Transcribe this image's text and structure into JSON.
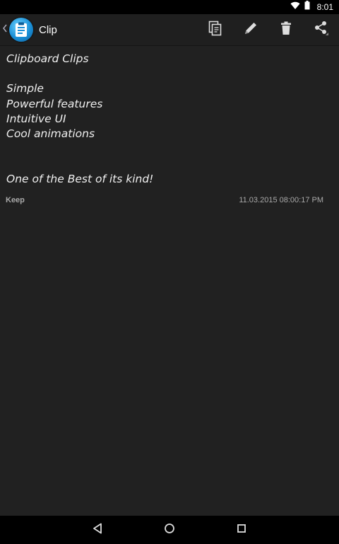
{
  "status_bar": {
    "time": "8:01",
    "icons": [
      "wifi-icon",
      "battery-icon"
    ]
  },
  "app_bar": {
    "title": "Clip",
    "actions": [
      "copy-icon",
      "edit-pencil-icon",
      "trash-icon",
      "share-icon"
    ]
  },
  "clip": {
    "lines": [
      "Clipboard Clips",
      "",
      "Simple",
      "Powerful features",
      "Intuitive UI",
      "Cool animations",
      "",
      "",
      "One of the Best of its kind!"
    ],
    "tag": "Keep",
    "timestamp": "11.03.2015  08:00:17 PM"
  },
  "nav_bar": {
    "buttons": [
      "back-triangle-icon",
      "home-circle-icon",
      "recents-square-icon"
    ]
  },
  "colors": {
    "background": "#212121",
    "app_bar": "#1f1f1f",
    "status_bar": "#000000",
    "logo_blue": "#1a8fd6"
  }
}
